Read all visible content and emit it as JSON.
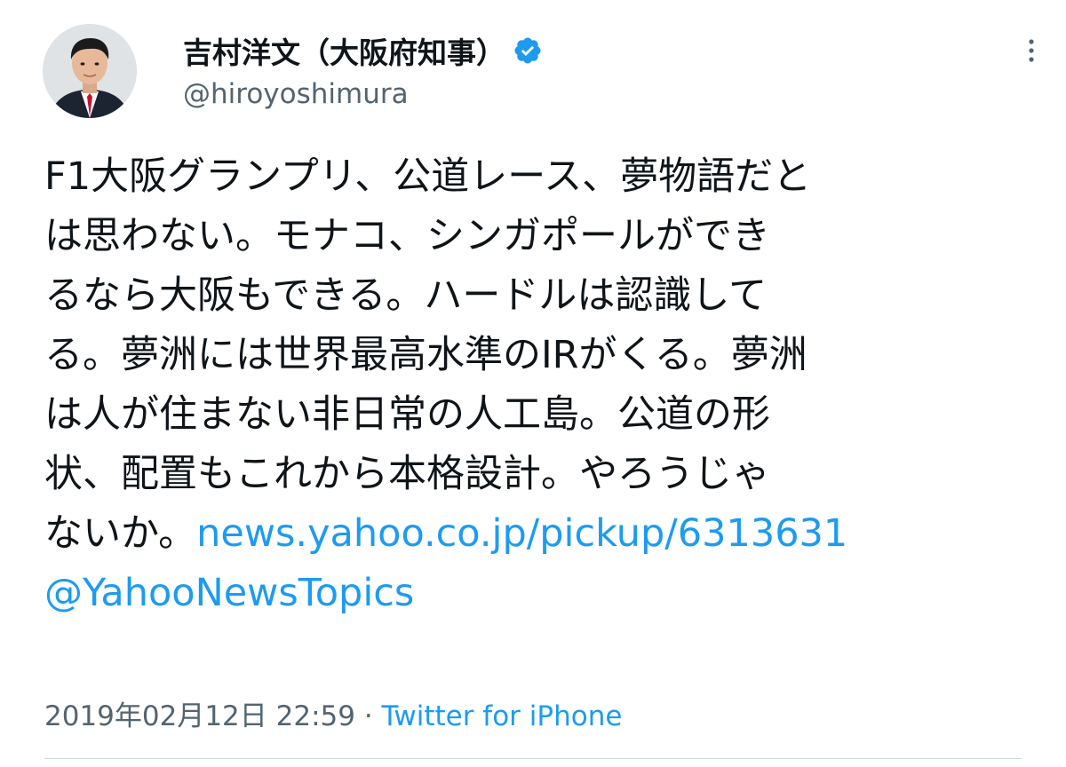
{
  "author": {
    "display_name": "吉村洋文（大阪府知事）",
    "handle": "@hiroyoshimura",
    "verified": true,
    "avatar_icon": "profile-photo"
  },
  "tweet": {
    "lines": [
      "F1大阪グランプリ、公道レース、夢物語だと",
      "は思わない。モナコ、シンガポールができ",
      "るなら大阪もできる。ハードルは認識して",
      "る。夢洲には世界最高水準のIRがくる。夢洲",
      "は人が住まない非日常の人工島。公道の形",
      "状、配置もこれから本格設計。やろうじゃ"
    ],
    "last_line_text": "ないか。",
    "link": "news.yahoo.co.jp/pickup/6313631",
    "mention": "@YahooNewsTopics"
  },
  "meta": {
    "timestamp": "2019年02月12日 22:59",
    "separator": " · ",
    "source": "Twitter for iPhone"
  },
  "colors": {
    "link": "#1d9bf0",
    "secondary_text": "#536471",
    "primary_text": "#0f1419",
    "verified_badge": "#1d9bf0"
  },
  "icons": {
    "more": "more-vertical-icon",
    "verified": "verified-badge-icon"
  }
}
